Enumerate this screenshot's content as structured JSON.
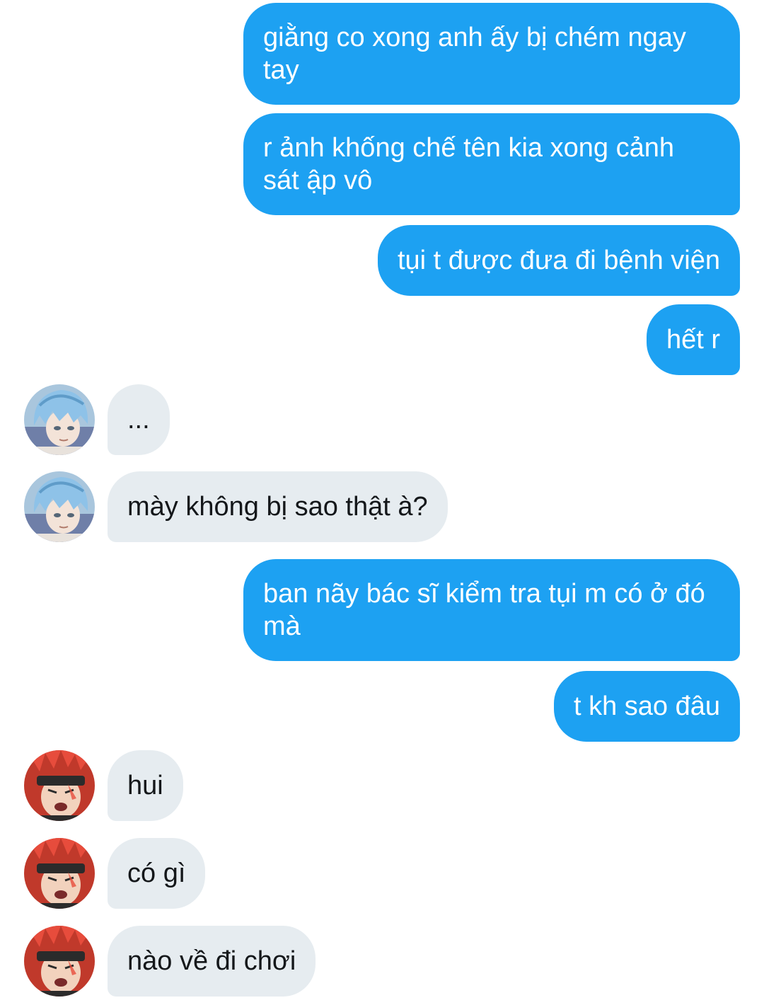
{
  "conversation": {
    "messages": [
      {
        "direction": "outgoing",
        "text": "giằng co xong anh ấy bị chém ngay\ntay"
      },
      {
        "direction": "outgoing",
        "text": "r ảnh khống chế tên kia xong cảnh\nsát ập vô"
      },
      {
        "direction": "outgoing",
        "text": "tụi t được đưa đi bệnh viện"
      },
      {
        "direction": "outgoing",
        "text": "hết r"
      },
      {
        "direction": "incoming",
        "avatar": "blue-haired-character-avatar",
        "text": "..."
      },
      {
        "direction": "incoming",
        "avatar": "blue-haired-character-avatar",
        "text": "mày không bị sao thật à?"
      },
      {
        "direction": "outgoing",
        "text": "ban nãy bác sĩ kiểm tra tụi m có ở đó\nmà"
      },
      {
        "direction": "outgoing",
        "text": "t kh sao đâu"
      },
      {
        "direction": "incoming",
        "avatar": "red-haired-character-avatar",
        "text": "hui"
      },
      {
        "direction": "incoming",
        "avatar": "red-haired-character-avatar",
        "text": "có gì"
      },
      {
        "direction": "incoming",
        "avatar": "red-haired-character-avatar",
        "text": "nào về đi chơi"
      }
    ]
  },
  "colors": {
    "outgoing_bubble": "#1da1f2",
    "outgoing_text": "#ffffff",
    "incoming_bubble": "#e6ecf0",
    "incoming_text": "#14171a",
    "background": "#ffffff"
  }
}
